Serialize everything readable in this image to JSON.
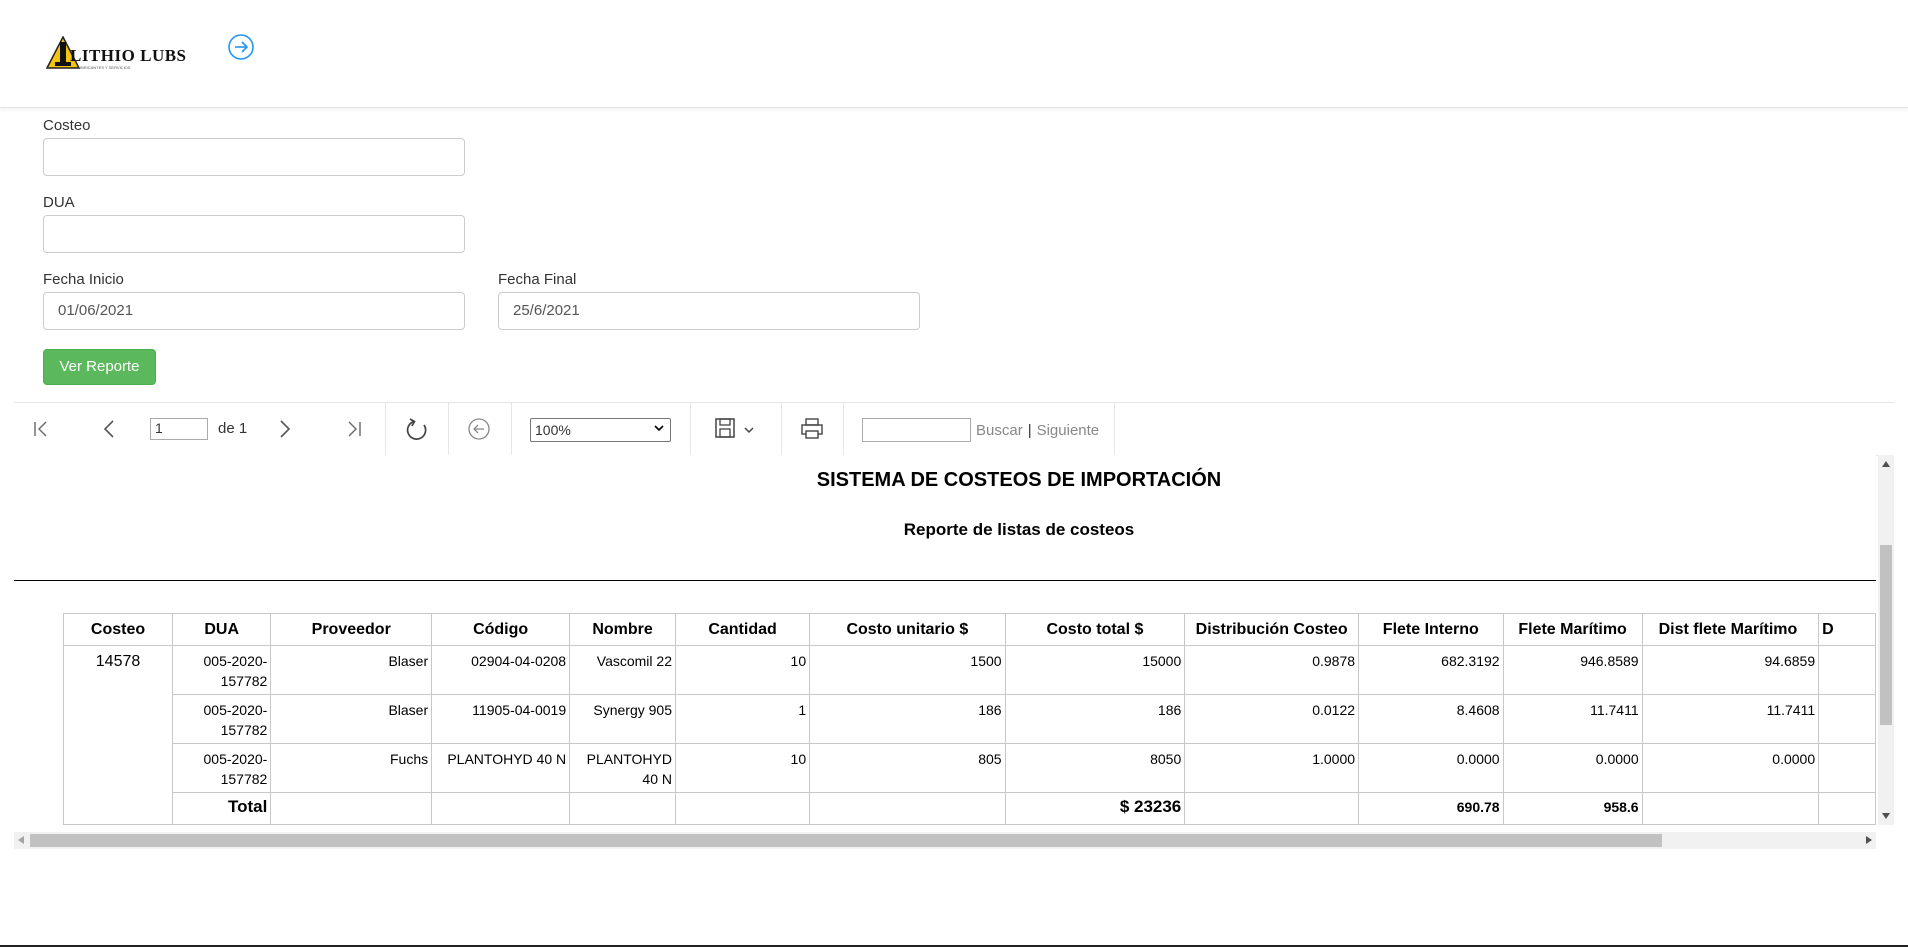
{
  "brand": {
    "logo_text": "LITHIO LUBS",
    "logo_tagline": "LUBRICANTES Y SERVICIOS"
  },
  "form": {
    "costeo": {
      "label": "Costeo",
      "value": ""
    },
    "dua": {
      "label": "DUA",
      "value": ""
    },
    "fecha_inicio": {
      "label": "Fecha Inicio",
      "value": "01/06/2021"
    },
    "fecha_final": {
      "label": "Fecha Final",
      "value": "25/6/2021"
    },
    "submit_label": "Ver Reporte"
  },
  "toolbar": {
    "page_value": "1",
    "page_of": "de 1",
    "zoom": "100%",
    "search_value": "",
    "buscar": "Buscar",
    "separator": "|",
    "siguiente": "Siguiente"
  },
  "report": {
    "title": "SISTEMA DE COSTEOS DE IMPORTACIÓN",
    "subtitle": "Reporte de listas de costeos",
    "columns": [
      "Costeo",
      "DUA",
      "Proveedor",
      "Código",
      "Nombre",
      "Cantidad",
      "Costo unitario $",
      "Costo total $",
      "Distribución Costeo",
      "Flete Interno",
      "Flete Marítimo",
      "Dist flete Marítimo",
      "D"
    ],
    "costeo": "14578",
    "rows": [
      {
        "dua_line1": "005-2020-",
        "dua_line2": "157782",
        "proveedor": "Blaser",
        "codigo": "02904-04-0208",
        "nombre_line1": "Vascomil 22",
        "nombre_line2": "",
        "cantidad": "10",
        "costo_unitario": "1500",
        "costo_total": "15000",
        "distribucion": "0.9878",
        "flete_interno": "682.3192",
        "flete_maritimo": "946.8589",
        "dist_flete_maritimo": "94.6859"
      },
      {
        "dua_line1": "005-2020-",
        "dua_line2": "157782",
        "proveedor": "Blaser",
        "codigo": "11905-04-0019",
        "nombre_line1": "Synergy 905",
        "nombre_line2": "",
        "cantidad": "1",
        "costo_unitario": "186",
        "costo_total": "186",
        "distribucion": "0.0122",
        "flete_interno": "8.4608",
        "flete_maritimo": "11.7411",
        "dist_flete_maritimo": "11.7411"
      },
      {
        "dua_line1": "005-2020-",
        "dua_line2": "157782",
        "proveedor": "Fuchs",
        "codigo": "PLANTOHYD 40 N",
        "nombre_line1": "PLANTOHYD",
        "nombre_line2": "40 N",
        "cantidad": "10",
        "costo_unitario": "805",
        "costo_total": "8050",
        "distribucion": "1.0000",
        "flete_interno": "0.0000",
        "flete_maritimo": "0.0000",
        "dist_flete_maritimo": "0.0000"
      }
    ],
    "total": {
      "label": "Total",
      "costo_total": "$ 23236",
      "flete_interno": "690.78",
      "flete_maritimo": "958.6"
    }
  }
}
